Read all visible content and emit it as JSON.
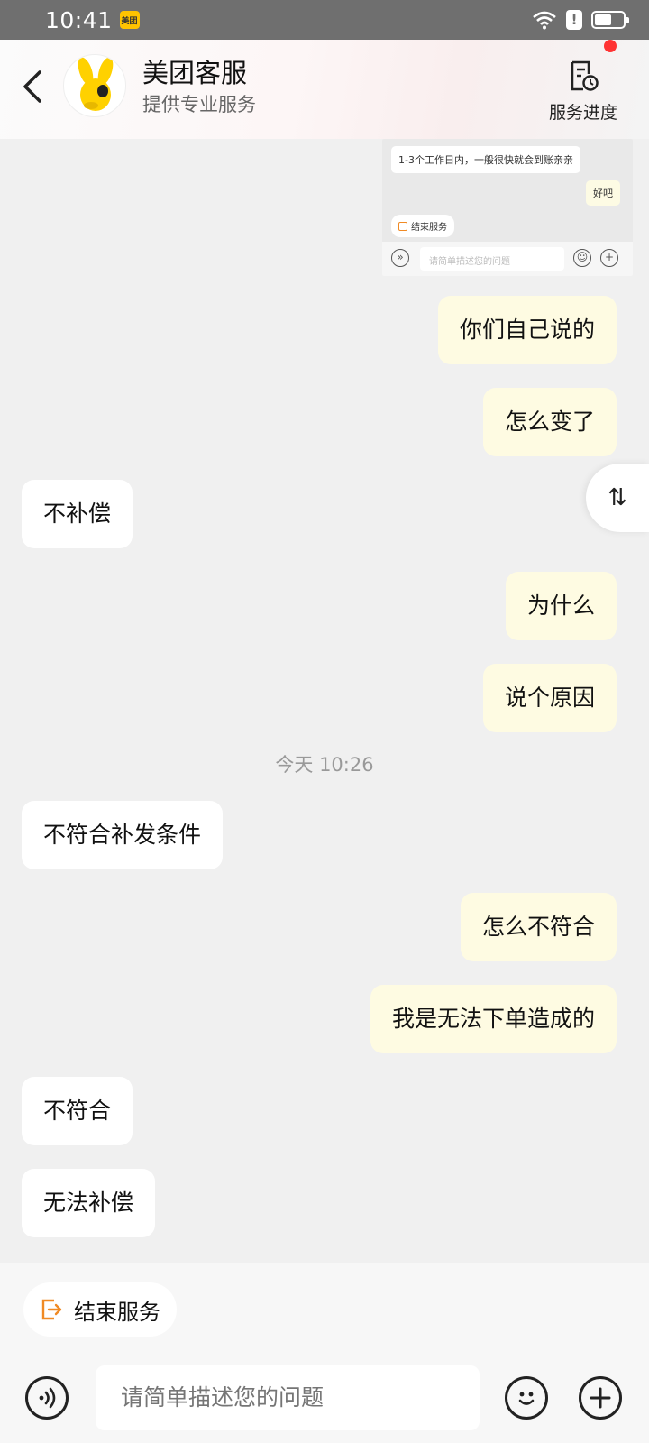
{
  "status_bar": {
    "time": "10:41",
    "app_badge": "美团"
  },
  "header": {
    "title": "美团客服",
    "subtitle": "提供专业服务",
    "progress_label": "服务进度"
  },
  "preview_thumbnail": {
    "message": "1-3个工作日内，一般很快就会到账亲亲",
    "reply": "好吧",
    "end_service": "结束服务",
    "input_placeholder": "请简单描述您的问题"
  },
  "messages": [
    {
      "side": "out",
      "text": "你们自己说的"
    },
    {
      "side": "out",
      "text": "怎么变了"
    },
    {
      "side": "in",
      "text": "不补偿"
    },
    {
      "side": "out",
      "text": "为什么"
    },
    {
      "side": "out",
      "text": "说个原因"
    },
    {
      "side": "in",
      "text": "不符合补发条件"
    },
    {
      "side": "out",
      "text": "怎么不符合"
    },
    {
      "side": "out",
      "text": "我是无法下单造成的"
    },
    {
      "side": "in",
      "text": "不符合"
    },
    {
      "side": "in",
      "text": "无法补偿"
    }
  ],
  "timestamp": "今天 10:26",
  "float_button": "⇅",
  "bottom": {
    "end_service_label": "结束服务",
    "input_placeholder": "请简单描述您的问题"
  },
  "colors": {
    "outgoing_bubble": "#fefbe2",
    "incoming_bubble": "#ffffff",
    "accent_orange": "#f08a24"
  }
}
